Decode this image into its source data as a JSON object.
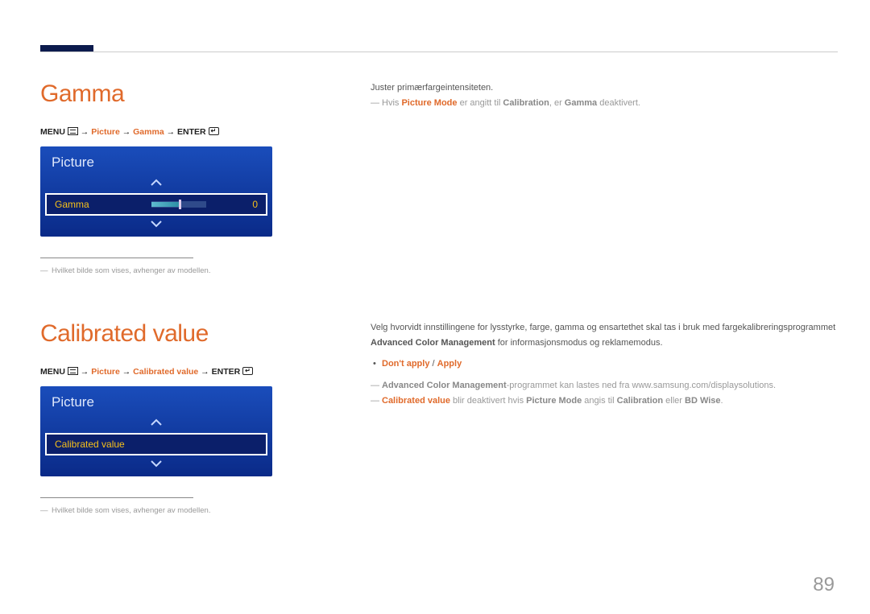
{
  "page_number": "89",
  "section1": {
    "heading": "Gamma",
    "path": {
      "prefix": "MENU",
      "seg1": "Picture",
      "seg2": "Gamma",
      "suffix": "ENTER"
    },
    "panel": {
      "title": "Picture",
      "option_label": "Gamma",
      "option_value": "0"
    },
    "footnote": "Hvilket bilde som vises, avhenger av modellen.",
    "right": {
      "line1": "Juster primærfargeintensiteten.",
      "note": {
        "t1": "Hvis ",
        "b1": "Picture Mode",
        "t2": " er angitt til ",
        "b2": "Calibration",
        "t3": ", er ",
        "b3": "Gamma",
        "t4": " deaktivert."
      }
    }
  },
  "section2": {
    "heading": "Calibrated value",
    "path": {
      "prefix": "MENU",
      "seg1": "Picture",
      "seg2": "Calibrated value",
      "suffix": "ENTER"
    },
    "panel": {
      "title": "Picture",
      "option_label": "Calibrated value"
    },
    "footnote": "Hvilket bilde som vises, avhenger av modellen.",
    "right": {
      "para1a": "Velg hvorvidt innstillingene for lysstyrke, farge, gamma og ensartethet skal tas i bruk med fargekalibreringsprogrammet ",
      "para1b": "Advanced Color Management",
      "para1c": " for informasjonsmodus og reklamemodus.",
      "bullet": {
        "opt1": "Don't apply",
        "sep": " / ",
        "opt2": "Apply"
      },
      "note1": {
        "b1": "Advanced Color Management",
        "t1": "-programmet kan lastes ned fra www.samsung.com/displaysolutions."
      },
      "note2": {
        "b1": "Calibrated value",
        "t1": " blir deaktivert hvis ",
        "b2": "Picture Mode",
        "t2": " angis til ",
        "b3": "Calibration",
        "t3": " eller ",
        "b4": "BD Wise",
        "t4": "."
      }
    }
  }
}
